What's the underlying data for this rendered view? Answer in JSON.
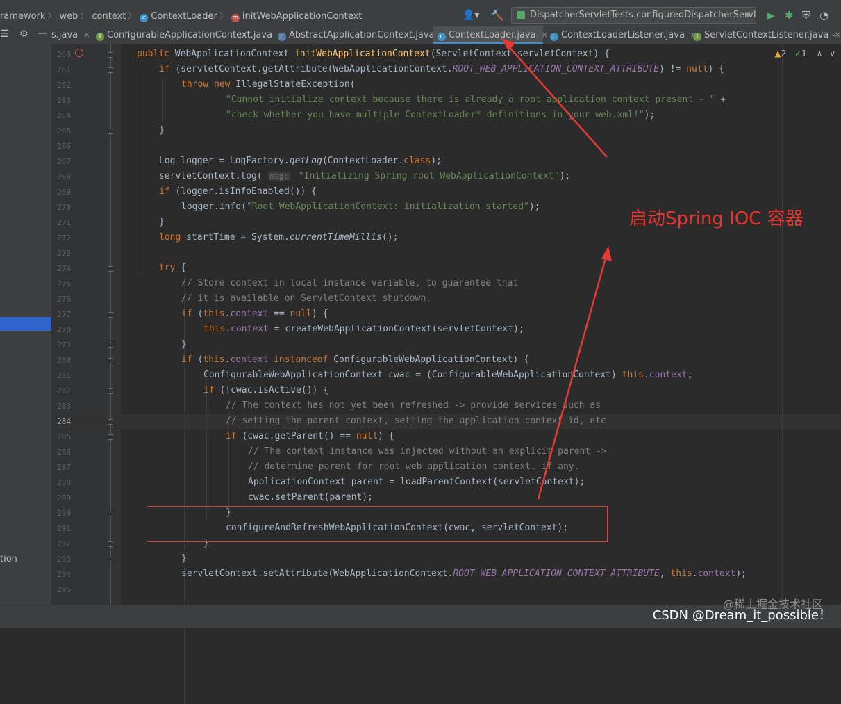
{
  "breadcrumbs": [
    {
      "label": "ramework",
      "icon": ""
    },
    {
      "label": "web",
      "icon": ""
    },
    {
      "label": "context",
      "icon": ""
    },
    {
      "label": "ContextLoader",
      "icon": "class-icon"
    },
    {
      "label": "initWebApplicationContext",
      "icon": "method-icon"
    }
  ],
  "run_config": {
    "label": "DispatcherServletTests.configuredDispatcherServlets"
  },
  "tabs": [
    {
      "label": "s.java",
      "icon": ""
    },
    {
      "label": "ConfigurableApplicationContext.java",
      "icon": "interface-icon"
    },
    {
      "label": "AbstractApplicationContext.java",
      "icon": "abstract-class-icon"
    },
    {
      "label": "ContextLoader.java",
      "icon": "class-icon",
      "active": true
    },
    {
      "label": "ContextLoaderListener.java",
      "icon": "class-icon"
    },
    {
      "label": "ServletContextListener.java",
      "icon": "interface-icon"
    }
  ],
  "inspections": {
    "warnings": "2",
    "ok": "1"
  },
  "left_panel": {
    "text": "tion"
  },
  "line_numbers": [
    "260",
    "261",
    "262",
    "263",
    "264",
    "265",
    "266",
    "267",
    "268",
    "269",
    "270",
    "271",
    "272",
    "273",
    "274",
    "275",
    "276",
    "277",
    "278",
    "279",
    "280",
    "281",
    "282",
    "283",
    "284",
    "285",
    "286",
    "287",
    "288",
    "289",
    "290",
    "291",
    "292",
    "293",
    "294",
    "295"
  ],
  "current_line": "284",
  "code_lines": [
    "public WebApplicationContext initWebApplicationContext(ServletContext servletContext) {",
    "if (servletContext.getAttribute(WebApplicationContext.ROOT_WEB_APPLICATION_CONTEXT_ATTRIBUTE) != null) {",
    "throw new IllegalStateException(",
    "\"Cannot initialize context because there is already a root application context present - \" +",
    "\"check whether you have multiple ContextLoader* definitions in your web.xml!\");",
    "}",
    "",
    "Log logger = LogFactory.getLog(ContextLoader.class);",
    "servletContext.log( msg: \"Initializing Spring root WebApplicationContext\");",
    "if (logger.isInfoEnabled()) {",
    "logger.info(\"Root WebApplicationContext: initialization started\");",
    "}",
    "long startTime = System.currentTimeMillis();",
    "",
    "try {",
    "// Store context in local instance variable, to guarantee that",
    "// it is available on ServletContext shutdown.",
    "if (this.context == null) {",
    "this.context = createWebApplicationContext(servletContext);",
    "}",
    "if (this.context instanceof ConfigurableWebApplicationContext) {",
    "ConfigurableWebApplicationContext cwac = (ConfigurableWebApplicationContext) this.context;",
    "if (!cwac.isActive()) {",
    "// The context has not yet been refreshed -> provide services such as",
    "// setting the parent context, setting the application context id, etc",
    "if (cwac.getParent() == null) {",
    "// The context instance was injected without an explicit parent ->",
    "// determine parent for root web application context, if any.",
    "ApplicationContext parent = loadParentContext(servletContext);",
    "cwac.setParent(parent);",
    "}",
    "configureAndRefreshWebApplicationContext(cwac, servletContext);",
    "}",
    "}",
    "servletContext.setAttribute(WebApplicationContext.ROOT_WEB_APPLICATION_CONTEXT_ATTRIBUTE, this.context);",
    ""
  ],
  "annotation": {
    "text": "启动Spring IOC 容器",
    "color": "#e8332e"
  },
  "watermark": {
    "line1": "@稀土掘金技术社区",
    "line2": "CSDN @Dream_it_possible！"
  },
  "colors": {
    "keyword": "#cc7832",
    "string": "#6a8759",
    "comment": "#808080",
    "field": "#9876aa",
    "method_decl": "#ffc66d",
    "active_tab_underline": "#4a88c7"
  }
}
